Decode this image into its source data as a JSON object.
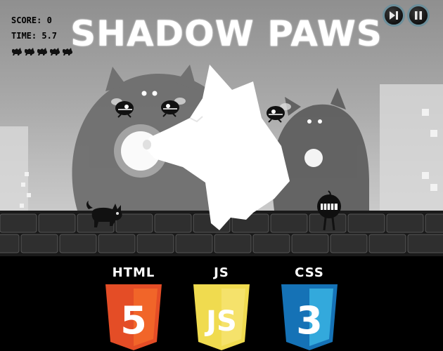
{
  "game": {
    "title": "SHADOW PAWS",
    "hud": {
      "score_text": "SCORE: 0",
      "time_text": "TIME: 5.7",
      "lives": 5,
      "life_icon": "paw-silhouette-icon"
    },
    "controls": {
      "skip_icon": "skip-forward-icon",
      "pause_icon": "pause-icon"
    }
  },
  "footer": {
    "technologies": [
      {
        "label": "HTML",
        "badge": "5",
        "color": "#e44d26",
        "icon": "html5-logo-icon"
      },
      {
        "label": "JS",
        "badge": "JS",
        "color": "#f0db4f",
        "icon": "js-logo-icon"
      },
      {
        "label": "CSS",
        "badge": "3",
        "color": "#1572b6",
        "icon": "css3-logo-icon"
      }
    ]
  },
  "colors": {
    "background": "#000000",
    "accent_ring": "#6d8f9b",
    "title": "#ffffff"
  }
}
